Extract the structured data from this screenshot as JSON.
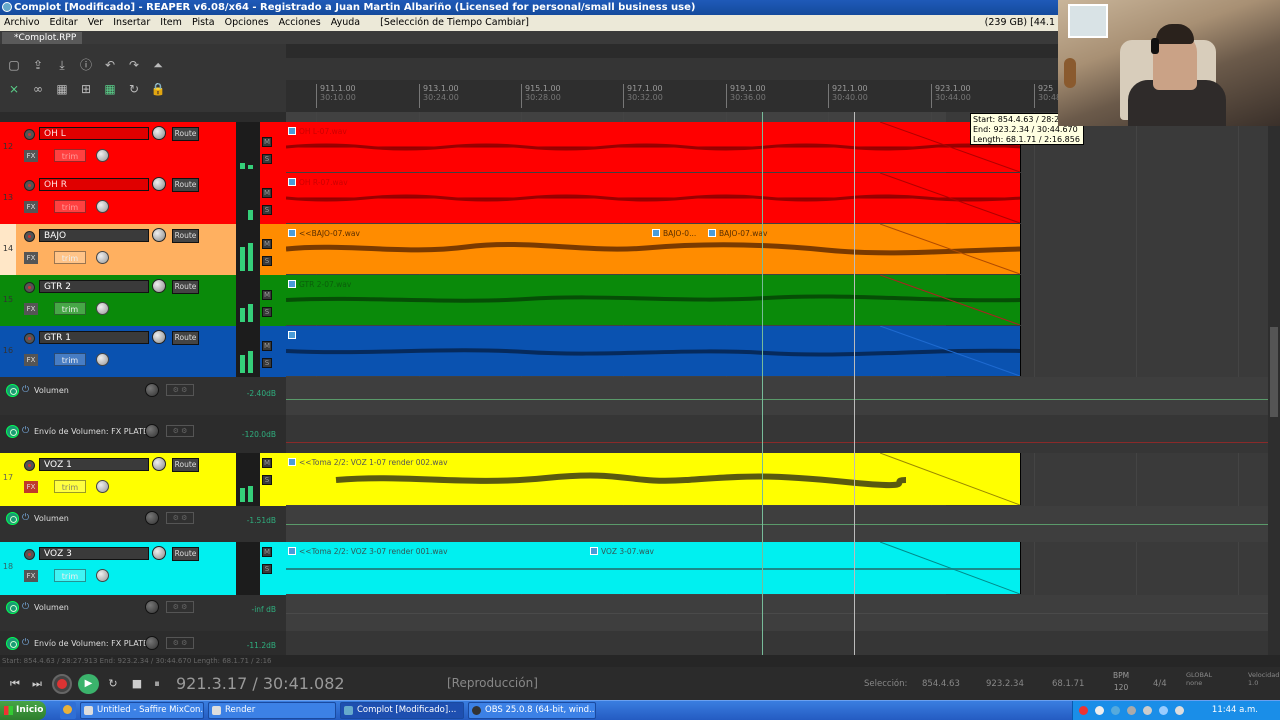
{
  "window": {
    "title": "Complot [Modificado] - REAPER v6.08/x64 - Registrado a Juan Martin Albariño (Licensed for personal/small business use)"
  },
  "menu": {
    "items": [
      "Archivo",
      "Editar",
      "Ver",
      "Insertar",
      "Item",
      "Pista",
      "Opciones",
      "Acciones",
      "Ayuda"
    ],
    "selection_note": "[Selección de Tiempo Cambiar]",
    "disk_info": "(239 GB) [44.1"
  },
  "project_tab": "*Complot.RPP",
  "ruler": {
    "ticks": [
      {
        "bar": "911.1.00",
        "time": "30:10.00"
      },
      {
        "bar": "913.1.00",
        "time": "30:24.00"
      },
      {
        "bar": "915.1.00",
        "time": "30:28.00"
      },
      {
        "bar": "917.1.00",
        "time": "30:32.00"
      },
      {
        "bar": "919.1.00",
        "time": "30:36.00"
      },
      {
        "bar": "921.1.00",
        "time": "30:40.00"
      },
      {
        "bar": "923.1.00",
        "time": "30:44.00"
      },
      {
        "bar": "925",
        "time": "30:48"
      }
    ]
  },
  "tracks": [
    {
      "num": "12",
      "name": "OH L",
      "color": "#ff0000",
      "text_color": "#5a0000",
      "route": "Route",
      "fx": "FX",
      "trim": "trim",
      "item_label": "OH L-07.wav",
      "item_labels": []
    },
    {
      "num": "13",
      "name": "OH R",
      "color": "#ff0000",
      "text_color": "#5a0000",
      "route": "Route",
      "fx": "FX",
      "trim": "trim",
      "item_label": "OH R-07.wav",
      "item_labels": []
    },
    {
      "num": "14",
      "name": "BAJO",
      "color": "#ff8c00",
      "text_color": "#4a2a00",
      "route": "Route",
      "fx": "FX",
      "trim": "trim",
      "item_label": "<<BAJO-07.wav",
      "item_labels": [
        "BAJO-0...",
        "BAJO-07.wav"
      ]
    },
    {
      "num": "15",
      "name": "GTR 2",
      "color": "#0a8a0a",
      "text_color": "#033a03",
      "route": "Route",
      "fx": "FX",
      "trim": "trim",
      "item_label": "GTR 2-07.wav",
      "item_labels": []
    },
    {
      "num": "16",
      "name": "GTR 1",
      "color": "#0a52b0",
      "text_color": "#062a5c",
      "route": "Route",
      "fx": "FX",
      "trim": "trim",
      "item_label": "",
      "item_labels": []
    }
  ],
  "envelopes_a": [
    {
      "label": "Volumen",
      "value": "-2.40dB"
    },
    {
      "label": "Envío de Volumen: FX PLATE",
      "value": "-120.0dB"
    }
  ],
  "voz1": {
    "num": "17",
    "name": "VOZ 1",
    "color": "#ffff00",
    "route": "Route",
    "fx": "FX",
    "trim": "trim",
    "item_label": "<<Toma 2/2: VOZ 1-07 render 002.wav",
    "env_label": "Volumen",
    "env_value": "-1.51dB"
  },
  "voz3": {
    "num": "18",
    "name": "VOZ 3",
    "color": "#00f0f0",
    "route": "Route",
    "fx": "FX",
    "trim": "trim",
    "item_label": "<<Toma 2/2: VOZ 3-07 render 001.wav",
    "item_label_2": "VOZ 3-07.wav",
    "env_label": "Volumen",
    "env_value": "-inf dB",
    "env2_label": "Envío de Volumen: FX PLATE V",
    "env2_value": "-11.2dB"
  },
  "tooltip": {
    "start": "Start: 854.4.63 / 28:2",
    "end": "End: 923.2.34 / 30:44.670",
    "length": "Length: 68.1.71 / 2:16.856"
  },
  "status_strip": "Start: 854.4.63 / 28:27.913 End: 923.2.34 / 30:44.670 Length: 68.1.71 / 2:16",
  "transport": {
    "position": "921.3.17 / 30:41.082",
    "state": "[Reproducción]",
    "selection_label": "Selección:",
    "sel_start": "854.4.63",
    "sel_end": "923.2.34",
    "sel_length": "68.1.71",
    "bpm_label": "BPM",
    "bpm": "120",
    "timesig": "4/4",
    "global": "GLOBAL",
    "global_mode": "none",
    "rate_label": "Velocidad",
    "rate": "1.0"
  },
  "taskbar": {
    "start": "Inicio",
    "buttons": [
      "Untitled - Saffire MixCon...",
      "Render",
      "Complot [Modificado]...",
      "OBS 25.0.8 (64-bit, wind..."
    ],
    "clock": "11:44 a.m."
  },
  "colors": {
    "meter_green": "#35d07a",
    "envelope_green": "#1a9a74",
    "play_green": "#3bb36c"
  }
}
